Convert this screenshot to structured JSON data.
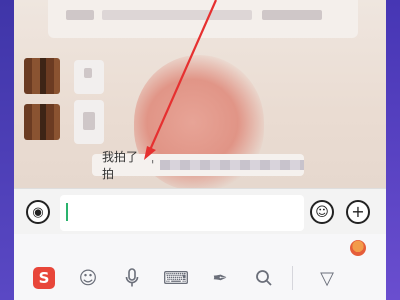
{
  "chat": {
    "system_message_prefix": "我拍了拍",
    "system_message_quote": "'"
  },
  "input": {
    "value": "",
    "placeholder": ""
  },
  "icons": {
    "voice": "voice-icon",
    "emoji": "emoji-icon",
    "plus": "plus-icon",
    "keyboard_logo": "sogou-logo-icon",
    "keyboard_emoji": "smile-icon",
    "keyboard_mic": "microphone-icon",
    "keyboard_layout": "keyboard-icon",
    "keyboard_handwrite": "feather-icon",
    "keyboard_search": "search-icon",
    "keyboard_collapse": "collapse-icon"
  },
  "glyphs": {
    "voice": "◉",
    "emoji": "☺",
    "plus": "+",
    "sogou": "S",
    "smile": "☺",
    "mic": "🎤",
    "keyboard": "⌨",
    "feather": "✒",
    "search": "⌕",
    "collapse": "▽"
  },
  "colors": {
    "arrow": "#e63030",
    "caret": "#2ab36d",
    "sogou": "#e8463a"
  }
}
